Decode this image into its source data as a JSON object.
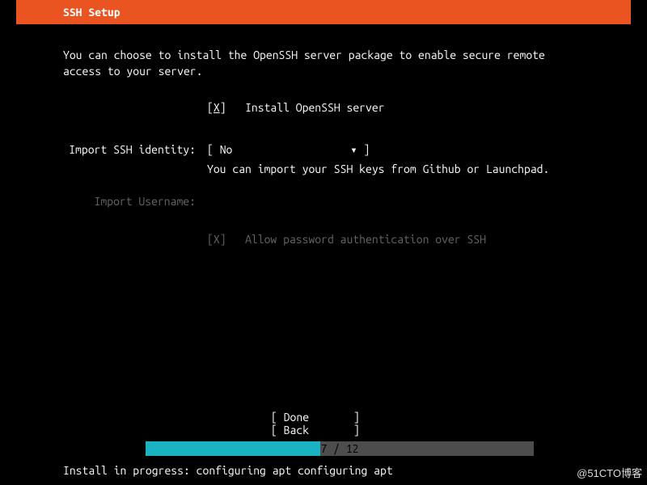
{
  "header": {
    "title": "SSH Setup"
  },
  "description": "You can choose to install the OpenSSH server package to enable secure remote access to your server.",
  "install_openssh": {
    "checkmark": "X",
    "label": "Install OpenSSH server"
  },
  "identity": {
    "label": "Import SSH identity:",
    "value": "No",
    "hint": "You can import your SSH keys from Github or Launchpad."
  },
  "username": {
    "label": "Import Username:"
  },
  "allow_password": {
    "checkmark": "X",
    "label": "Allow password authentication over SSH"
  },
  "buttons": {
    "done": "Done",
    "back": "Back"
  },
  "progress": {
    "current": 7,
    "total": 12,
    "text": "7 / 12",
    "percent": 45
  },
  "status": "Install in progress: configuring apt configuring apt",
  "watermark": "@51CTO博客",
  "glyphs": {
    "dropdown_arrow": "▾",
    "lbr": "[",
    "rbr": "]"
  }
}
